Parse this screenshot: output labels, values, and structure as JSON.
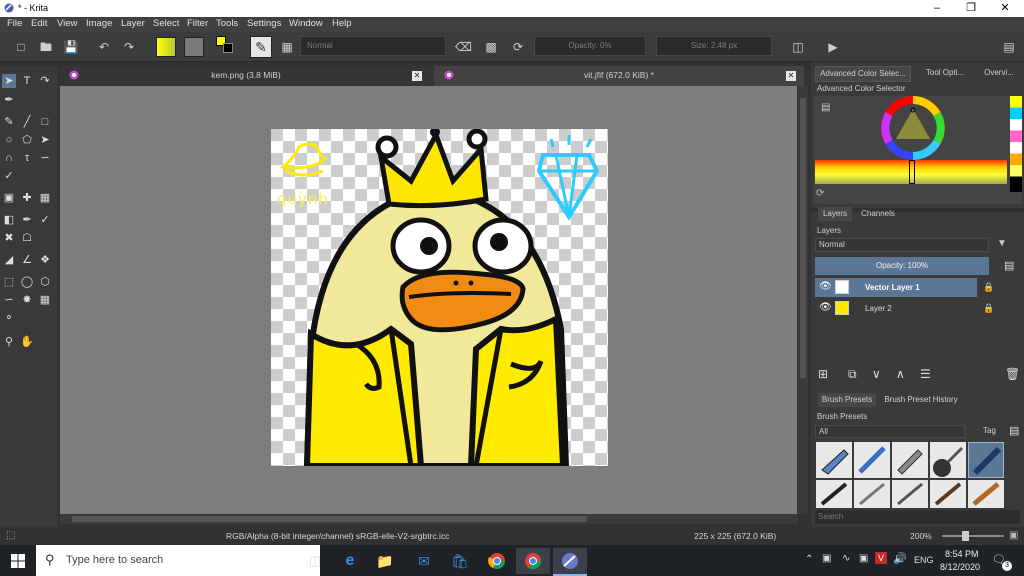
{
  "window": {
    "title": "* - Krita"
  },
  "menu": [
    "File",
    "Edit",
    "View",
    "Image",
    "Layer",
    "Select",
    "Filter",
    "Tools",
    "Settings",
    "Window",
    "Help"
  ],
  "toolbar": {
    "blend_mode": "Normal",
    "opacity": "Opacity: 0%",
    "size": "Size: 2.48 px"
  },
  "tabs": [
    {
      "label": "kem.png (3.8 MiB)"
    },
    {
      "label": "vit.jfif (672.0 KiB) *"
    }
  ],
  "canvas_art": {
    "name_text": "quỳnh"
  },
  "right_panel": {
    "top_tabs": [
      "Advanced Color Selec...",
      "Tool Opti...",
      "Overvi..."
    ],
    "color_selector_title": "Advanced Color Selector",
    "layers_tabs": [
      "Layers",
      "Channels"
    ],
    "layers_title": "Layers",
    "layer_blend": "Normal",
    "layer_opacity": "Opacity:  100%",
    "layers": [
      {
        "name": "Vector Layer 1",
        "selected": true
      },
      {
        "name": "Layer 2",
        "selected": false
      }
    ],
    "brush_tabs": [
      "Brush Presets",
      "Brush Preset History"
    ],
    "brush_title": "Brush Presets",
    "brush_filter": "All",
    "tag_label": "Tag",
    "search_placeholder": "Search"
  },
  "status": {
    "color_info": "RGB/Alpha (8-bit integer/channel)  sRGB-elle-V2-srgbtrc.icc",
    "dimensions": "225 x 225 (672.0 KiB)",
    "zoom": "200%"
  },
  "taskbar": {
    "search_placeholder": "Type here to search",
    "language": "ENG",
    "time": "8:54 PM",
    "date": "8/12/2020",
    "notifications": "3"
  },
  "colors": {
    "foreground": "#ffff00",
    "background": "#000000",
    "accent": "#5c7796"
  }
}
